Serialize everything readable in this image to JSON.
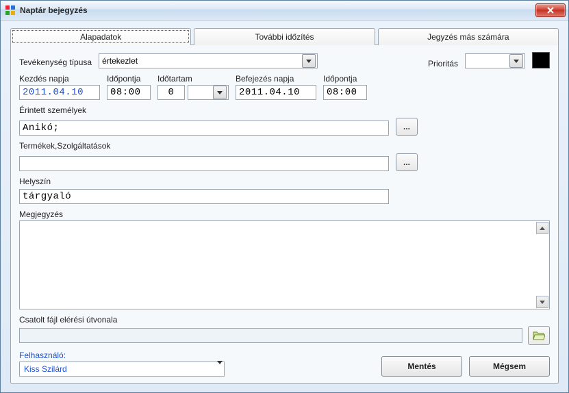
{
  "window": {
    "title": "Naptár bejegyzés"
  },
  "tabs": {
    "basic": "Alapadatok",
    "timing": "További időzítés",
    "entryfor": "Jegyzés más számára"
  },
  "activity_type": {
    "label": "Tevékenység típusa",
    "value": "értekezlet"
  },
  "priority": {
    "label": "Prioritás",
    "value": "",
    "color": "#000000"
  },
  "start_date": {
    "label": "Kezdés napja",
    "value": "2011.04.10"
  },
  "start_time": {
    "label": "Időpontja",
    "value": "08:00"
  },
  "duration": {
    "label": "Időtartam",
    "value": "0",
    "unit": ""
  },
  "end_date": {
    "label": "Befejezés napja",
    "value": "2011.04.10"
  },
  "end_time": {
    "label": "Időpontja",
    "value": "08:00"
  },
  "persons": {
    "label": "Érintett személyek",
    "value": "Anikó;"
  },
  "products": {
    "label": "Termékek,Szolgáltatások",
    "value": ""
  },
  "location": {
    "label": "Helyszín",
    "value": "tárgyaló"
  },
  "note": {
    "label": "Megjegyzés",
    "value": ""
  },
  "attachment": {
    "label": "Csatolt fájl elérési útvonala",
    "value": ""
  },
  "user": {
    "label": "Felhasználó:",
    "value": "Kiss Szilárd"
  },
  "buttons": {
    "save": "Mentés",
    "cancel": "Mégsem",
    "ellipsis": "..."
  },
  "icons": {
    "app": "calendar-color-icon",
    "close": "close-icon",
    "dropdown": "chevron-down-icon",
    "folder": "folder-open-icon"
  }
}
